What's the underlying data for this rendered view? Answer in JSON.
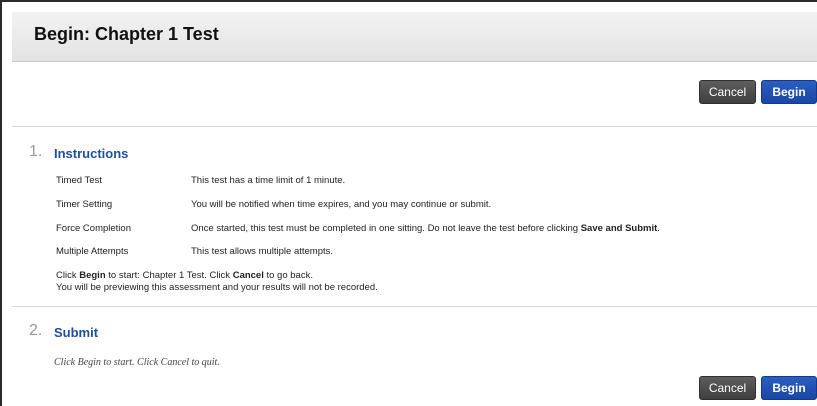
{
  "header": {
    "title": "Begin: Chapter 1 Test"
  },
  "actions_top": {
    "cancel_label": "Cancel",
    "begin_label": "Begin"
  },
  "instructions": {
    "number": "1.",
    "title": "Instructions",
    "rows": [
      {
        "label": "Timed Test",
        "value": "This test has a time limit of 1 minute."
      },
      {
        "label": "Timer Setting",
        "value": "You will be notified when time expires, and you may continue or submit."
      },
      {
        "label": "Force Completion",
        "value_prefix": "Once started, this test must be completed in one sitting. Do not leave the test before clicking ",
        "value_bold": "Save and Submit",
        "value_suffix": "."
      },
      {
        "label": "Multiple Attempts",
        "value": "This test allows multiple attempts."
      }
    ],
    "note_line1": {
      "p1": "Click ",
      "b1": "Begin",
      "p2": " to start: Chapter 1 Test. Click ",
      "b2": "Cancel",
      "p3": " to go back."
    },
    "note_line2": "You will be previewing this assessment and your results will not be recorded."
  },
  "submit": {
    "number": "2.",
    "title": "Submit",
    "note": "Click Begin to start. Click Cancel to quit."
  },
  "actions_bottom": {
    "cancel_label": "Cancel",
    "begin_label": "Begin"
  }
}
